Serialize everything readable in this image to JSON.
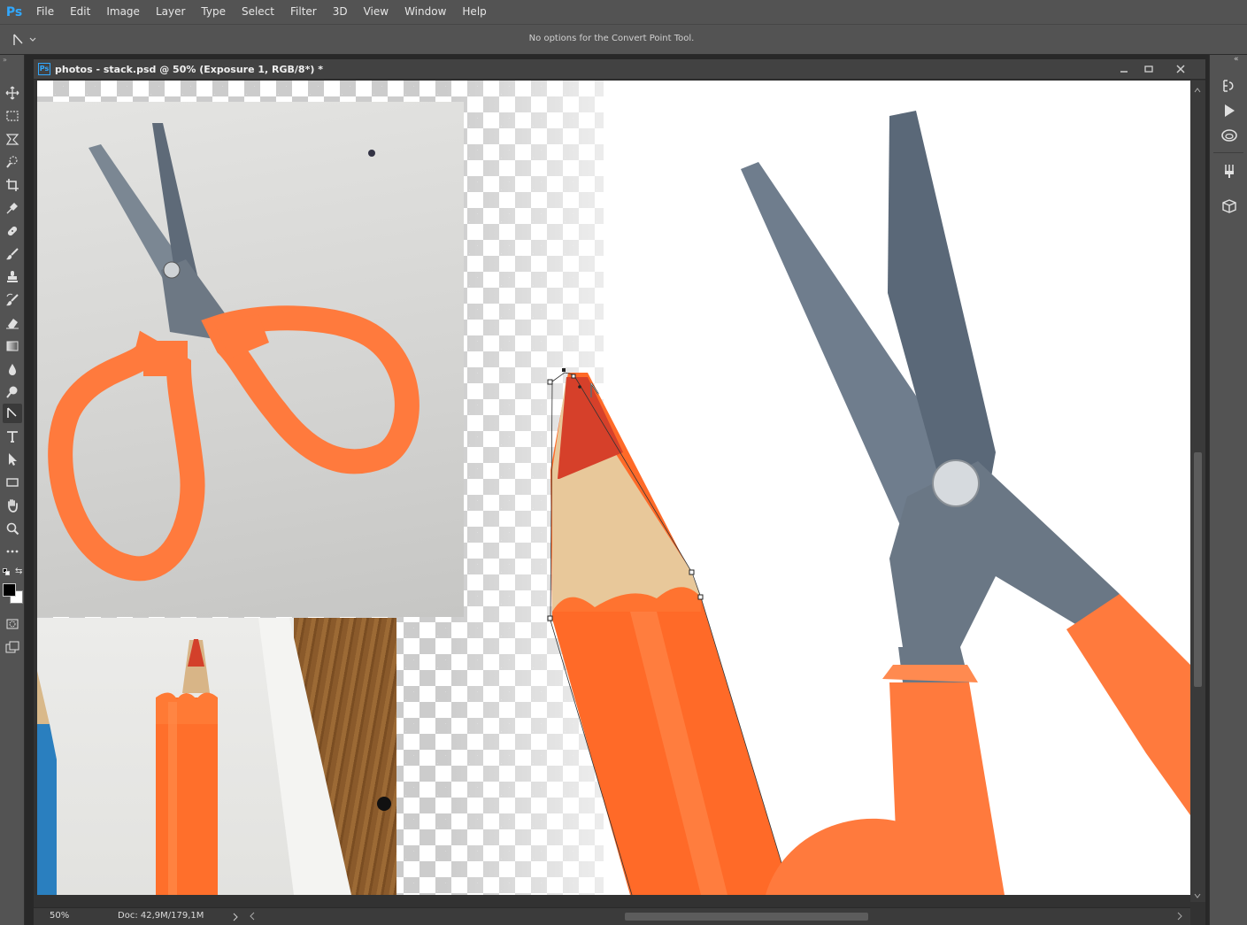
{
  "app": {
    "logo": "Ps"
  },
  "menu": [
    "File",
    "Edit",
    "Image",
    "Layer",
    "Type",
    "Select",
    "Filter",
    "3D",
    "View",
    "Window",
    "Help"
  ],
  "options_bar": {
    "text": "No options for the Convert Point Tool."
  },
  "document": {
    "title": "photos - stack.psd @ 50% (Exposure 1, RGB/8*) *",
    "badge": "Ps"
  },
  "status": {
    "zoom": "50%",
    "doc_size": "Doc: 42,9M/179,1M"
  },
  "toolbar": {
    "active_tool": "convert-point-tool",
    "tools": [
      "move-tool",
      "marquee-tool",
      "lasso-tool",
      "quick-select-tool",
      "crop-tool",
      "eyedropper-tool",
      "healing-brush-tool",
      "brush-tool",
      "clone-stamp-tool",
      "history-brush-tool",
      "eraser-tool",
      "gradient-tool",
      "blur-tool",
      "dodge-tool",
      "convert-point-tool",
      "type-tool",
      "path-select-tool",
      "rectangle-tool",
      "hand-tool",
      "zoom-tool",
      "more-tools"
    ]
  },
  "colors": {
    "foreground": "#000000",
    "background": "#ffffff",
    "accent": "#31a8ff"
  }
}
